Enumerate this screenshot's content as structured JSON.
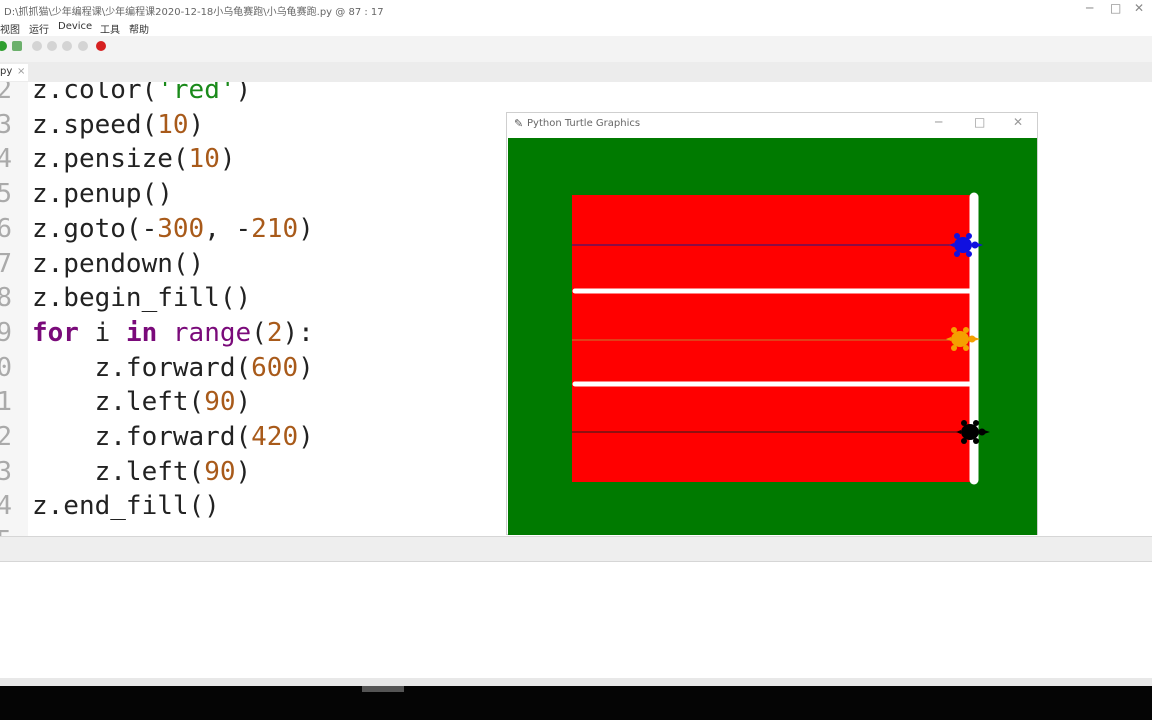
{
  "window": {
    "title": "D:\\抓抓猫\\少年编程课\\少年编程课2020-12-18小乌龟赛跑\\小乌龟赛跑.py  @  87 : 17",
    "minimize": "─",
    "maximize": "□",
    "close": "✕"
  },
  "menu": [
    "视图",
    "运行",
    "Device",
    "工具",
    "帮助"
  ],
  "toolbar": {
    "icons": [
      "run-icon",
      "debug-icon",
      "step-over-icon",
      "step-into-icon",
      "step-out-icon",
      "resume-icon",
      "stop-icon"
    ]
  },
  "tab": {
    "label": "py",
    "close": "×"
  },
  "editor": {
    "line_numbers": [
      "2",
      "3",
      "4",
      "5",
      "6",
      "7",
      "8",
      "9",
      "0",
      "1",
      "2",
      "3",
      "4",
      "5"
    ],
    "lines": [
      [
        {
          "t": "z.color(",
          "c": ""
        },
        {
          "t": "'red'",
          "c": "str"
        },
        {
          "t": ")",
          "c": ""
        }
      ],
      [
        {
          "t": "z.speed(",
          "c": ""
        },
        {
          "t": "10",
          "c": "num"
        },
        {
          "t": ")",
          "c": ""
        }
      ],
      [
        {
          "t": "z.pensize(",
          "c": ""
        },
        {
          "t": "10",
          "c": "num"
        },
        {
          "t": ")",
          "c": ""
        }
      ],
      [
        {
          "t": "z.penup()",
          "c": ""
        }
      ],
      [
        {
          "t": "z.goto(-",
          "c": ""
        },
        {
          "t": "300",
          "c": "num"
        },
        {
          "t": ", -",
          "c": ""
        },
        {
          "t": "210",
          "c": "num"
        },
        {
          "t": ")",
          "c": ""
        }
      ],
      [
        {
          "t": "z.pendown()",
          "c": ""
        }
      ],
      [
        {
          "t": "z.begin_fill()",
          "c": ""
        }
      ],
      [
        {
          "t": "for",
          "c": "kw"
        },
        {
          "t": " i ",
          "c": ""
        },
        {
          "t": "in",
          "c": "kw"
        },
        {
          "t": " ",
          "c": ""
        },
        {
          "t": "range",
          "c": "fn"
        },
        {
          "t": "(",
          "c": ""
        },
        {
          "t": "2",
          "c": "num"
        },
        {
          "t": "):",
          "c": ""
        }
      ],
      [
        {
          "t": "    z.forward(",
          "c": ""
        },
        {
          "t": "600",
          "c": "num"
        },
        {
          "t": ")",
          "c": ""
        }
      ],
      [
        {
          "t": "    z.left(",
          "c": ""
        },
        {
          "t": "90",
          "c": "num"
        },
        {
          "t": ")",
          "c": ""
        }
      ],
      [
        {
          "t": "    z.forward(",
          "c": ""
        },
        {
          "t": "420",
          "c": "num"
        },
        {
          "t": ")",
          "c": ""
        }
      ],
      [
        {
          "t": "    z.left(",
          "c": ""
        },
        {
          "t": "90",
          "c": "num"
        },
        {
          "t": ")",
          "c": ""
        }
      ],
      [
        {
          "t": "z.end_fill()",
          "c": ""
        }
      ]
    ]
  },
  "turtle_window": {
    "title": "Python Turtle Graphics",
    "minimize": "─",
    "maximize": "□",
    "close": "✕",
    "colors": {
      "background": "#007a00",
      "track": "#ff0000",
      "divider": "#ffffff",
      "finish_line": "#ffffff"
    },
    "turtles": [
      {
        "name": "blue-turtle",
        "color": "#1010e0",
        "lane": 1
      },
      {
        "name": "orange-turtle",
        "color": "#f5a000",
        "lane": 2
      },
      {
        "name": "black-turtle",
        "color": "#000000",
        "lane": 3
      }
    ]
  }
}
